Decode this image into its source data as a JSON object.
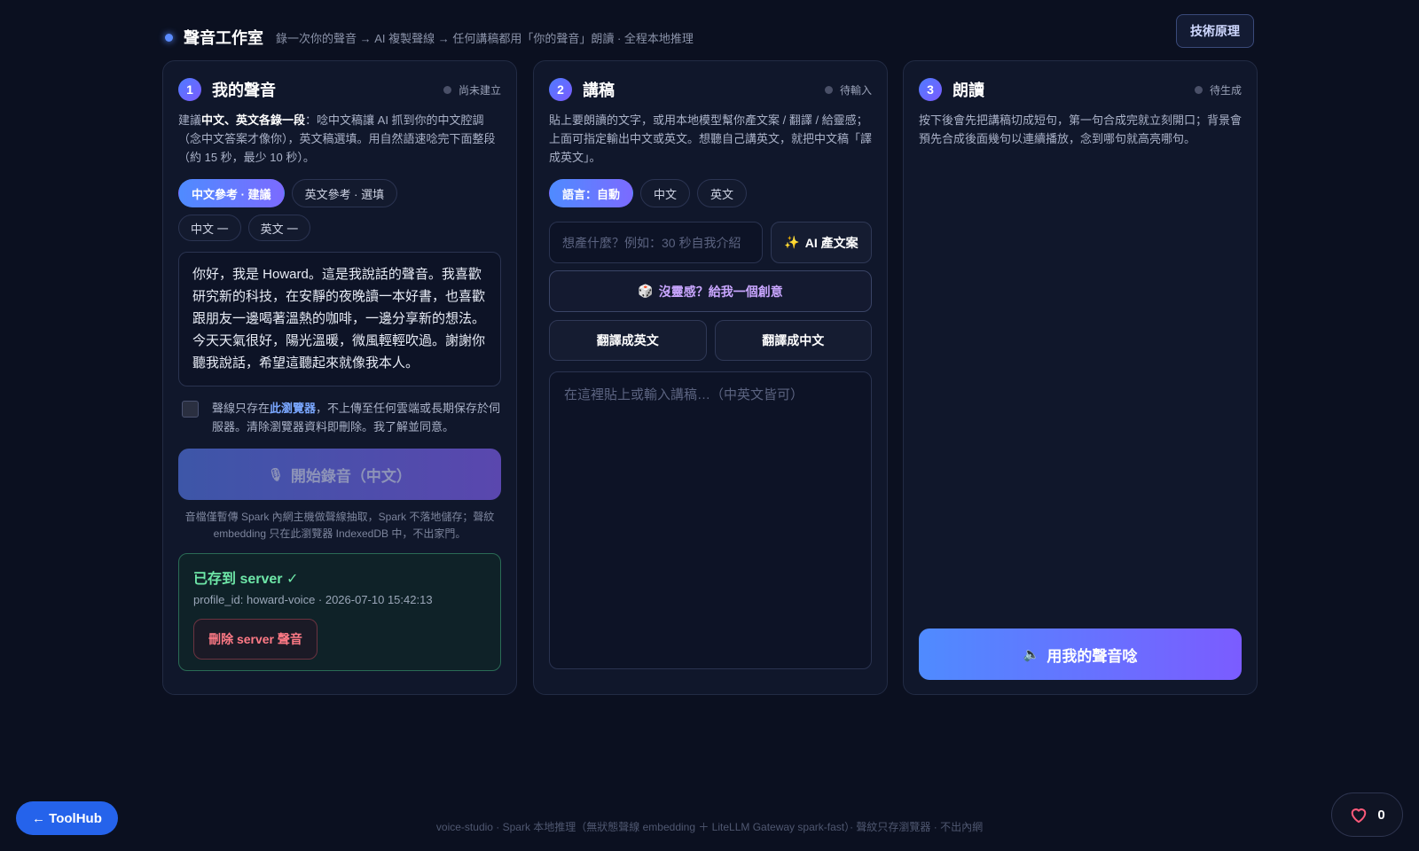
{
  "header": {
    "title": "聲音工作室",
    "subtitle": "錄一次你的聲音 → AI 複製聲線 → 任何講稿都用「你的聲音」朗讀 · 全程本地推理",
    "tech_button": "技術原理"
  },
  "panel1": {
    "number": "1",
    "title": "我的聲音",
    "status": "尚未建立",
    "desc_prefix": "建議",
    "desc_bold": "中文、英文各錄一段",
    "desc_rest": "：唸中文稿讓 AI 抓到你的中文腔調（念中文答案才像你），英文稿選填。用自然語速唸完下面整段（約 15 秒，最少 10 秒）。",
    "chips": [
      "中文參考 · 建議",
      "英文參考 · 選填"
    ],
    "sub_chips": [
      "中文 一",
      "英文 一"
    ],
    "script_text": "你好，我是 Howard。這是我說話的聲音。我喜歡研究新的科技，在安靜的夜晚讀一本好書，也喜歡跟朋友一邊喝著溫熱的咖啡，一邊分享新的想法。今天天氣很好，陽光溫暖，微風輕輕吹過。謝謝你聽我說話，希望這聽起來就像我本人。",
    "consent_prefix": "聲線只存在",
    "consent_highlight": "此瀏覽器",
    "consent_rest": "，不上傳至任何雲端或長期保存於伺服器。清除瀏覽器資料即刪除。我了解並同意。",
    "record_button": "開始錄音（中文）",
    "note": "音檔僅暫傳 Spark 內網主機做聲線抽取，Spark 不落地儲存；聲紋 embedding 只在此瀏覽器 IndexedDB 中，不出家門。",
    "saved_title": "已存到 server ✓",
    "saved_meta": "profile_id: howard-voice · 2026-07-10 15:42:13",
    "delete_button": "刪除 server 聲音"
  },
  "panel2": {
    "number": "2",
    "title": "講稿",
    "status": "待輸入",
    "desc": "貼上要朗讀的文字，或用本地模型幫你產文案 / 翻譯 / 給靈感；上面可指定輸出中文或英文。想聽自己講英文，就把中文稿「譯成英文」。",
    "lang_chips": [
      "語言：自動",
      "中文",
      "英文"
    ],
    "ai_placeholder": "想產什麼？例如：30 秒自我介紹",
    "ai_button": "AI 產文案",
    "idea_button": "沒靈感？給我一個創意",
    "translate_en": "翻譯成英文",
    "translate_zh": "翻譯成中文",
    "script_placeholder": "在這裡貼上或輸入講稿…（中英文皆可）"
  },
  "panel3": {
    "number": "3",
    "title": "朗讀",
    "status": "待生成",
    "desc": "按下後會先把講稿切成短句，第一句合成完就立刻開口；背景會預先合成後面幾句以連續播放，念到哪句就高亮哪句。",
    "read_button": "用我的聲音唸"
  },
  "footer": {
    "text": "voice-studio · Spark 本地推理（無狀態聲線 embedding ＋ LiteLLM Gateway spark-fast）· 聲紋只存瀏覽器 · 不出內網",
    "toolhub": "← ToolHub",
    "likes": "0"
  }
}
